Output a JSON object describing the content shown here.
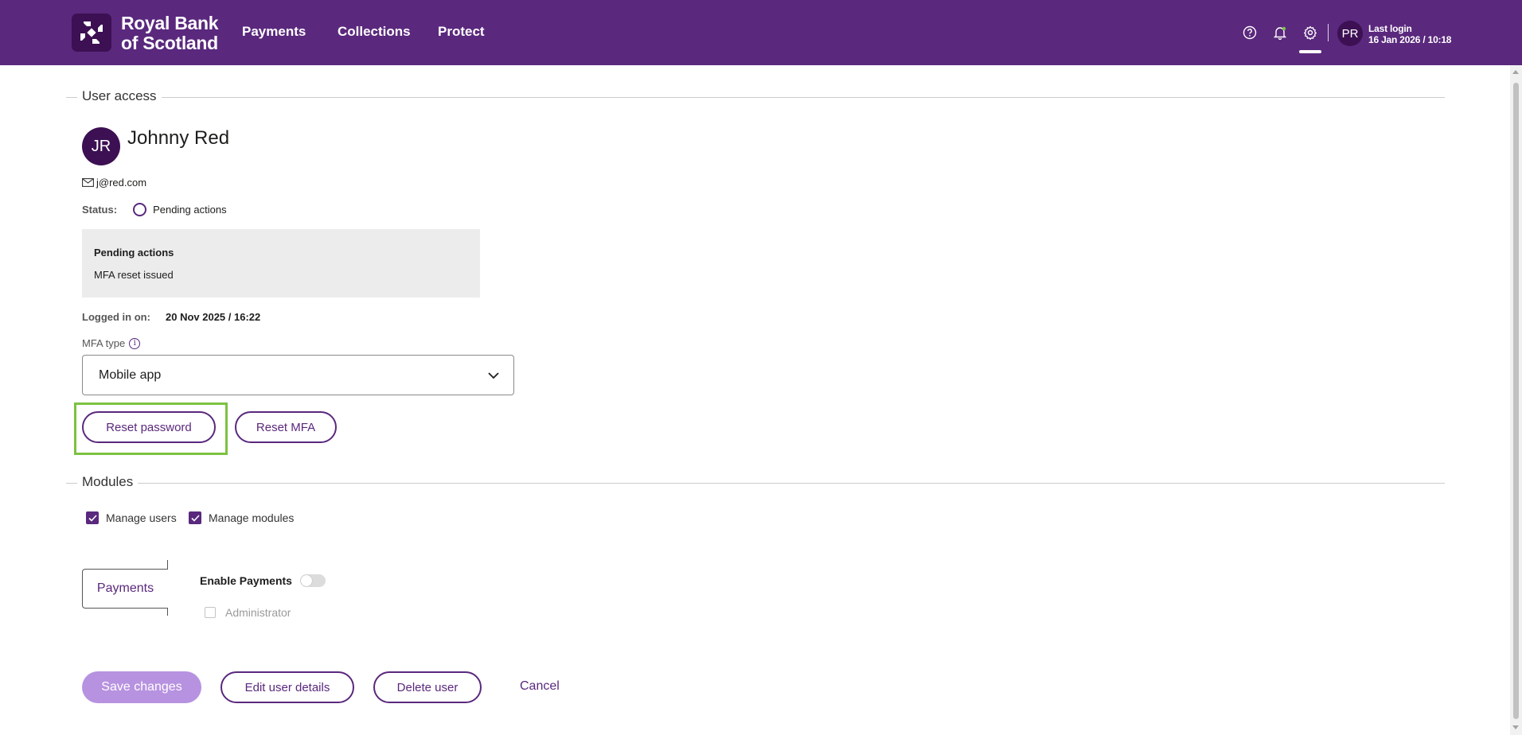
{
  "header": {
    "brand_line1": "Royal Bank",
    "brand_line2": "of Scotland",
    "nav": [
      "Payments",
      "Collections",
      "Protect"
    ],
    "avatar_initials": "PR",
    "last_login_label": "Last login",
    "last_login_value": "16 Jan 2026 / 10:18",
    "icons": [
      "help-icon",
      "bell-icon",
      "gear-icon"
    ]
  },
  "user_access": {
    "section_title": "User access",
    "avatar_initials": "JR",
    "name": "Johnny Red",
    "email": "j@red.com",
    "status_label": "Status:",
    "status_value": "Pending actions",
    "pending_title": "Pending actions",
    "pending_item": "MFA reset issued",
    "logged_label": "Logged in on:",
    "logged_value": "20 Nov 2025 / 16:22",
    "mfa_label": "MFA type",
    "mfa_value": "Mobile app",
    "reset_password": "Reset password",
    "reset_mfa": "Reset MFA"
  },
  "modules": {
    "section_title": "Modules",
    "checkboxes": [
      {
        "label": "Manage users",
        "checked": true
      },
      {
        "label": "Manage modules",
        "checked": true
      }
    ],
    "tab_label": "Payments",
    "enable_label": "Enable Payments",
    "enable_on": false,
    "admin_label": "Administrator",
    "admin_checked": false
  },
  "actions": {
    "save": "Save changes",
    "edit": "Edit user details",
    "delete": "Delete user",
    "cancel": "Cancel"
  },
  "colors": {
    "brand_purple": "#5a287d",
    "dark_purple": "#3c1053",
    "save_disabled": "#b792e0",
    "highlight": "#7cc242"
  }
}
